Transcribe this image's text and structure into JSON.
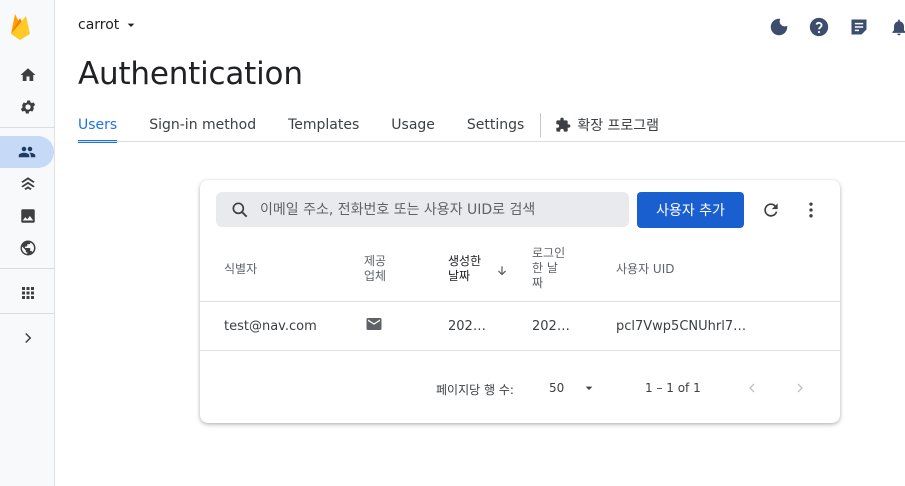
{
  "app": {
    "project_name": "carrot",
    "page_title": "Authentication"
  },
  "rail": {
    "items": [
      {
        "icon": "home-icon"
      },
      {
        "icon": "gear-icon"
      },
      {
        "icon": "people-icon",
        "active": true
      },
      {
        "icon": "hosting-icon"
      },
      {
        "icon": "image-icon"
      },
      {
        "icon": "globe-icon"
      },
      {
        "icon": "apps-grid-icon"
      },
      {
        "icon": "chevron-right-icon"
      }
    ]
  },
  "tabs": [
    {
      "label": "Users",
      "active": true
    },
    {
      "label": "Sign-in method"
    },
    {
      "label": "Templates"
    },
    {
      "label": "Usage"
    },
    {
      "label": "Settings"
    }
  ],
  "extensions_tab": {
    "label": "확장 프로그램"
  },
  "search": {
    "placeholder": "이메일 주소, 전화번호 또는 사용자 UID로 검색"
  },
  "toolbar": {
    "add_user_label": "사용자 추가"
  },
  "table": {
    "columns": {
      "identifier": "식별자",
      "provider_line1": "제공",
      "provider_line2": "업체",
      "created_line1": "생성한",
      "created_line2": "날짜",
      "signin_line1": "로그인",
      "signin_line2": "한 날",
      "signin_line3": "짜",
      "uid": "사용자 UID"
    },
    "rows": [
      {
        "identifier": "test@nav.com",
        "provider": "email",
        "created": "202…",
        "signed_in": "202…",
        "uid": "pcl7Vwp5CNUhrl7…"
      }
    ]
  },
  "pagination": {
    "rows_per_page_label": "페이지당 행 수:",
    "rows_per_page_value": "50",
    "range": "1 – 1 of 1"
  },
  "colors": {
    "accent": "#1a73e8",
    "button": "#1a5fd0",
    "rail_active": "#c6d9f7"
  }
}
